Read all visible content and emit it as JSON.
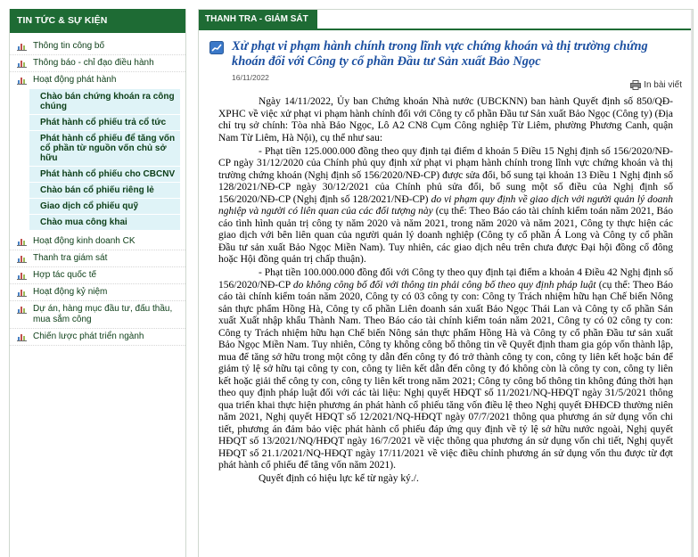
{
  "sidebar": {
    "header": "TIN TỨC & SỰ KIỆN",
    "items": [
      {
        "label": "Thông tin công bố"
      },
      {
        "label": "Thông báo - chỉ đạo điều hành"
      },
      {
        "label": "Hoạt động phát hành"
      }
    ],
    "sub_items": [
      "Chào bán chứng khoán ra công chúng",
      "Phát hành cổ phiếu trả cổ tức",
      "Phát hành cổ phiếu để tăng vốn cổ phần từ nguồn vốn chủ sở hữu",
      "Phát hành cổ phiếu cho CBCNV",
      "Chào bán cổ phiếu riêng lẻ",
      "Giao dịch cổ phiếu quỹ",
      "Chào mua công khai"
    ],
    "items_after": [
      "Hoạt động kinh doanh CK",
      "Thanh tra giám sát",
      "Hợp tác quốc tế",
      "Hoạt động kỷ niệm",
      "Dự án, hàng mục đầu tư, đấu thầu, mua sắm công",
      "Chiến lược phát triển ngành"
    ]
  },
  "main": {
    "tab": "THANH TRA - GIÁM SÁT",
    "title": "Xử phạt vi phạm hành chính trong lĩnh vực chứng khoán và thị trường chứng khoán đối với Công ty cổ phần Đầu tư Sản xuất Bảo Ngọc",
    "date": "16/11/2022",
    "print_label": "In bài viết",
    "p1": "Ngày 14/11/2022, Ủy ban Chứng khoán Nhà nước (UBCKNN) ban hành Quyết định số 850/QĐ-XPHC về việc xử phạt vi phạm hành chính đối với Công ty cổ phần Đầu tư Sản xuất Bảo Ngọc (Công ty) (Địa chỉ trụ sở chính: Tòa nhà Bảo Ngọc, Lô A2 CN8 Cụm Công nghiệp Từ Liêm, phường Phương Canh, quận Nam Từ Liêm, Hà Nội), cụ thể như sau:",
    "p2_a": "- Phạt tiền 125.000.000 đồng theo quy định tại điểm d khoản 5 Điều 15 Nghị định số 156/2020/NĐ-CP ngày 31/12/2020 của Chính phủ quy định xử phạt vi phạm hành chính trong lĩnh vực chứng khoán và thị trường chứng khoán (Nghị định số 156/2020/NĐ-CP) được sửa đổi, bổ sung tại khoản 13 Điều 1 Nghị định số 128/2021/NĐ-CP ngày 30/12/2021 của Chính phủ sửa đổi, bổ sung một số điều của Nghị định số 156/2020/NĐ-CP (Nghị định số 128/2021/NĐ-CP) ",
    "p2_em": "do vi phạm quy định về giao dịch với người quản lý doanh nghiệp và người có liên quan của các đối tượng này",
    "p2_b": " (cụ thể: Theo Báo cáo tài chính kiểm toán năm 2021, Báo cáo tình hình quản trị công ty năm 2020 và năm 2021, trong năm 2020 và năm 2021, Công ty thực hiện các giao dịch với bên liên quan của người quản lý doanh nghiệp (Công ty cổ phần Á Long và Công ty cổ phần Đầu tư sản xuất Bảo Ngọc Miền Nam). Tuy nhiên, các giao dịch nêu trên chưa được Đại hội đồng cổ đông hoặc Hội đồng quản trị chấp thuận).",
    "p3_a": "- Phạt tiền 100.000.000 đồng đối với Công ty theo quy định tại điểm a khoản 4 Điều 42 Nghị định số 156/2020/NĐ-CP ",
    "p3_em": "do không công bố đối với thông tin phải công bố theo quy định pháp luật",
    "p3_b": " (cụ thể: Theo Báo cáo tài chính kiểm toán năm 2020, Công ty có 03 công ty con: Công ty Trách nhiệm hữu hạn Chế biến Nông sản thực phẩm Hồng Hà, Công ty cổ phần Liên doanh sản xuất Bảo Ngọc Thái Lan và Công ty cổ phần Sản xuất Xuất nhập khẩu Thành Nam. Theo Báo cáo tài chính kiểm toán năm 2021, Công ty có 02 công ty con: Công ty Trách nhiệm hữu hạn Chế biến Nông sản thực phẩm Hồng Hà và Công ty cổ phần Đầu tư sản xuất Bảo Ngọc Miền Nam. Tuy nhiên, Công ty không công bố thông tin về Quyết định tham gia góp vốn thành lập, mua để tăng sở hữu trong một công ty dẫn đến công ty đó trở thành công ty con, công ty liên kết hoặc bán để giảm tỷ lệ sở hữu tại công ty con, công ty liên kết dẫn đến công ty đó không còn là công ty con, công ty liên kết hoặc giải thể công ty con, công ty liên kết trong năm 2021; Công ty công bố thông tin không đúng thời hạn theo quy định pháp luật đối với các tài liệu: Nghị quyết HĐQT số 11/2021/NQ-HĐQT ngày 31/5/2021 thông qua triển khai thực hiện phương án phát hành cổ phiếu tăng vốn điều lệ theo Nghị quyết ĐHĐCĐ thường niên năm 2021, Nghị quyết HĐQT số 12/2021/NQ-HĐQT ngày 07/7/2021 thông qua phương án sử dụng vốn chi tiết, phương án đảm bảo việc phát hành cổ phiếu đáp ứng quy định về tỷ lệ sở hữu nước ngoài, Nghị quyết HĐQT số 13/2021/NQ/HĐQT ngày 16/7/2021 về việc thông qua phương án sử dụng vốn chi tiết, Nghị quyết HĐQT số 21.1/2021/NQ-HĐQT ngày 17/11/2021 về việc điều chỉnh phương án sử dụng vốn thu được từ đợt phát hành cổ phiếu để tăng vốn năm 2021).",
    "p4": "Quyết định có hiệu lực kể từ ngày ký./."
  },
  "colors": {
    "brand_green": "#1e6b34",
    "title_blue": "#1b4fa0",
    "submenu_bg": "#dff3f7"
  }
}
